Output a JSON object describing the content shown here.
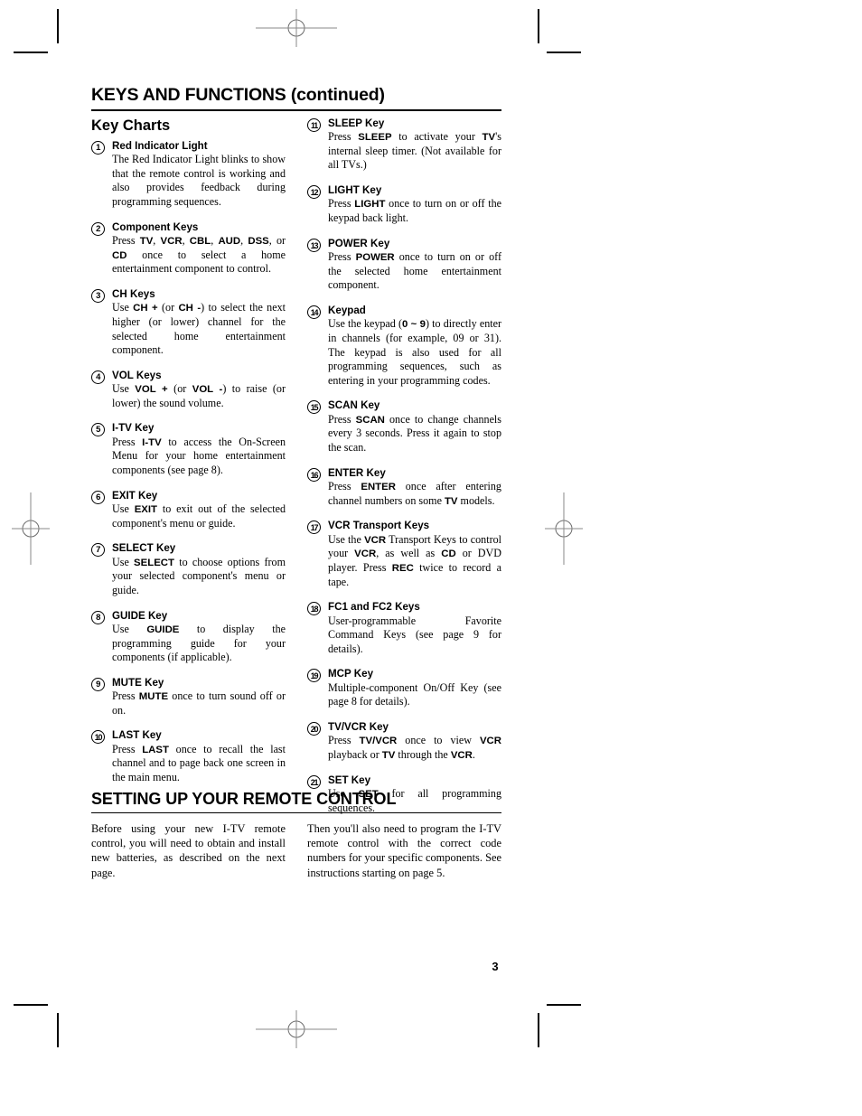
{
  "header": {
    "title_main": "KEYS AND FUNCTIONS",
    "title_suffix": " (continued)",
    "subtitle": "Key Charts"
  },
  "key_charts": {
    "left_column": [
      {
        "number": "1",
        "title": "Red Indicator Light",
        "body": "The Red Indicator Light blinks to show that the remote control is working and also provides feedback during programming sequences."
      },
      {
        "number": "2",
        "title": "Component Keys",
        "body": "Press TV, VCR, CBL, AUD, DSS, or CD once to select a home entertainment component to control."
      },
      {
        "number": "3",
        "title": "CH Keys",
        "body": "Use CH + (or CH -) to select the next higher (or lower) channel for the selected home entertainment component."
      },
      {
        "number": "4",
        "title": "VOL Keys",
        "body": "Use VOL + (or VOL -) to raise (or lower) the sound volume."
      },
      {
        "number": "5",
        "title": "I-TV Key",
        "body": "Press I-TV to access the On-Screen Menu for your home entertainment components  (see page 8)."
      },
      {
        "number": "6",
        "title": "EXIT Key",
        "body": "Use EXIT to exit out of the selected component's menu or guide."
      },
      {
        "number": "7",
        "title": "SELECT Key",
        "body": "Use SELECT to choose options from your selected component's menu or guide."
      },
      {
        "number": "8",
        "title": "GUIDE Key",
        "body": "Use GUIDE to display the programming guide for your components (if applicable)."
      },
      {
        "number": "9",
        "title": "MUTE Key",
        "body": "Press MUTE once to turn sound off or on."
      },
      {
        "number": "10",
        "title": "LAST Key",
        "body": "Press LAST once to recall the last channel and to page back one screen in the main menu."
      }
    ],
    "right_column": [
      {
        "number": "11",
        "title": "SLEEP Key",
        "body": "Press SLEEP to activate your TV's internal sleep timer. (Not available for all TVs.)"
      },
      {
        "number": "12",
        "title": "LIGHT Key",
        "body": "Press LIGHT once to turn on or off the keypad back light."
      },
      {
        "number": "13",
        "title": "POWER Key",
        "body": "Press POWER once to turn on or off the selected home entertainment component."
      },
      {
        "number": "14",
        "title": "Keypad",
        "body": "Use the keypad (0 ~ 9) to directly enter in channels (for example, 09 or 31). The keypad is also used for all programming sequences, such as entering in your programming codes."
      },
      {
        "number": "15",
        "title": "SCAN Key",
        "body": "Press SCAN once to change channels every 3 seconds. Press it again to stop the scan."
      },
      {
        "number": "16",
        "title": "ENTER Key",
        "body": "Press ENTER once after entering channel numbers on some TV models."
      },
      {
        "number": "17",
        "title": "VCR Transport Keys",
        "body": "Use the VCR Transport Keys to control your VCR, as well as CD or DVD player. Press REC twice to record a tape."
      },
      {
        "number": "18",
        "title": "FC1 and FC2 Keys",
        "body": "User-programmable Favorite Command Keys (see page 9 for details)."
      },
      {
        "number": "19",
        "title": "MCP Key",
        "body": "Multiple-component On/Off Key (see page 8 for details)."
      },
      {
        "number": "20",
        "title": "TV/VCR Key",
        "body": "Press TV/VCR once to view VCR playback or TV through the VCR."
      },
      {
        "number": "21",
        "title": "SET Key",
        "body": "Use SET for all programming sequences."
      }
    ]
  },
  "setup_section": {
    "title": "SETTING UP YOUR REMOTE CONTROL",
    "paragraph_left": "Before using your new I-TV remote control, you will need to obtain and install new batteries, as described on the next page.",
    "paragraph_right": "Then you'll also need to program the I-TV remote control with the correct code numbers for your specific components. See instructions starting on page 5."
  },
  "footer": {
    "page_number": "3"
  }
}
